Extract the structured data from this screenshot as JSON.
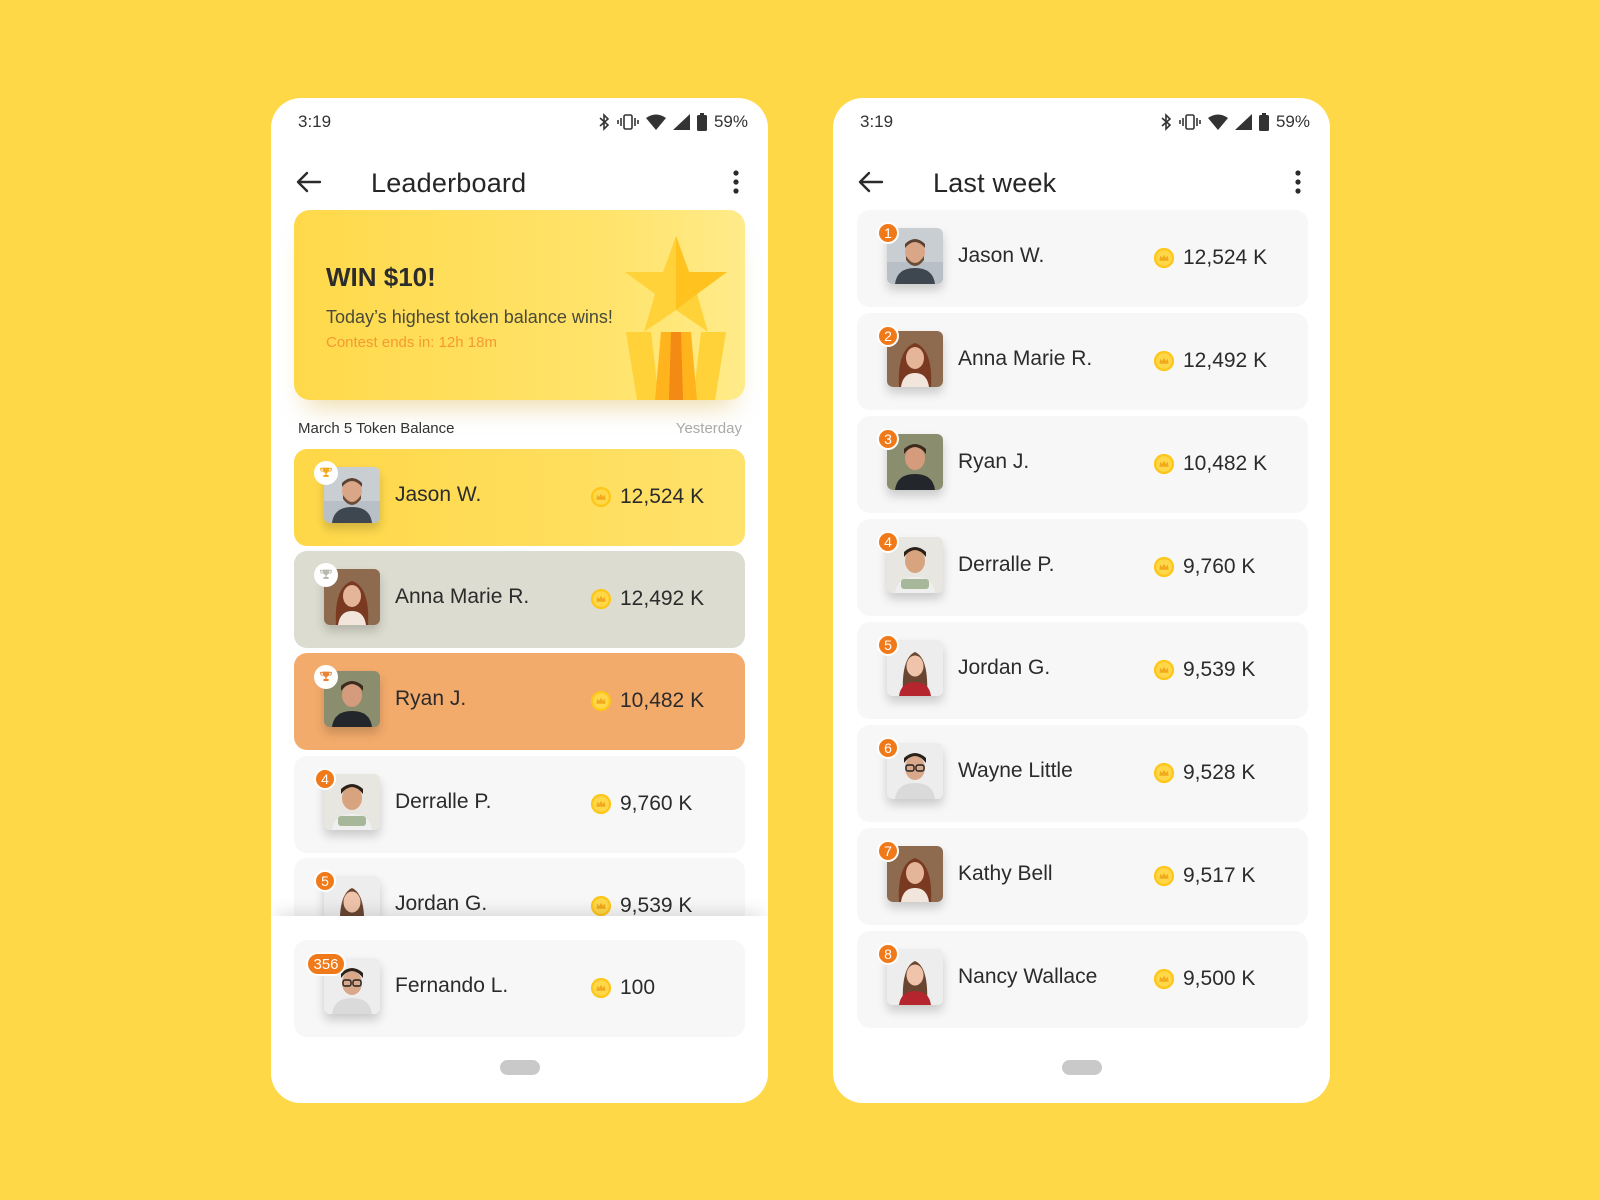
{
  "status_bar": {
    "time": "3:19",
    "battery": "59%"
  },
  "screens": [
    {
      "title": "Leaderboard",
      "promo": {
        "title": "WIN $10!",
        "subtitle": "Today’s highest token balance wins!",
        "countdown": "Contest ends in: 12h 18m"
      },
      "section": {
        "label": "March 5 Token Balance",
        "date": "Yesterday"
      },
      "rows": [
        {
          "rank": "1",
          "name": "Jason W.",
          "score": "12,524 K"
        },
        {
          "rank": "2",
          "name": "Anna Marie R.",
          "score": "12,492 K"
        },
        {
          "rank": "3",
          "name": "Ryan J.",
          "score": "10,482 K"
        },
        {
          "rank": "4",
          "name": "Derralle P.",
          "score": "9,760 K"
        },
        {
          "rank": "5",
          "name": "Jordan G.",
          "score": "9,539 K"
        }
      ],
      "current_user": {
        "rank": "356",
        "name": "Fernando L.",
        "score": "100"
      }
    },
    {
      "title": "Last week",
      "rows": [
        {
          "rank": "1",
          "name": "Jason W.",
          "score": "12,524 K"
        },
        {
          "rank": "2",
          "name": "Anna Marie R.",
          "score": "12,492 K"
        },
        {
          "rank": "3",
          "name": "Ryan J.",
          "score": "10,482 K"
        },
        {
          "rank": "4",
          "name": "Derralle P.",
          "score": "9,760 K"
        },
        {
          "rank": "5",
          "name": "Jordan G.",
          "score": "9,539 K"
        },
        {
          "rank": "6",
          "name": "Wayne Little",
          "score": "9,528 K"
        },
        {
          "rank": "7",
          "name": "Kathy Bell",
          "score": "9,517 K"
        },
        {
          "rank": "8",
          "name": "Nancy Wallace",
          "score": "9,500 K"
        }
      ]
    }
  ],
  "icons": {
    "back": "arrow-left-icon",
    "more": "more-vertical-icon",
    "coin": "coin-crown-icon",
    "trophy": "trophy-icon"
  },
  "colors": {
    "background": "#FFD848",
    "accent_orange": "#F07A1A",
    "gold_row": "#FFD848",
    "silver_row": "#DCDCD0",
    "bronze_row": "#F3AB6C",
    "row_default": "#F7F7F7"
  }
}
